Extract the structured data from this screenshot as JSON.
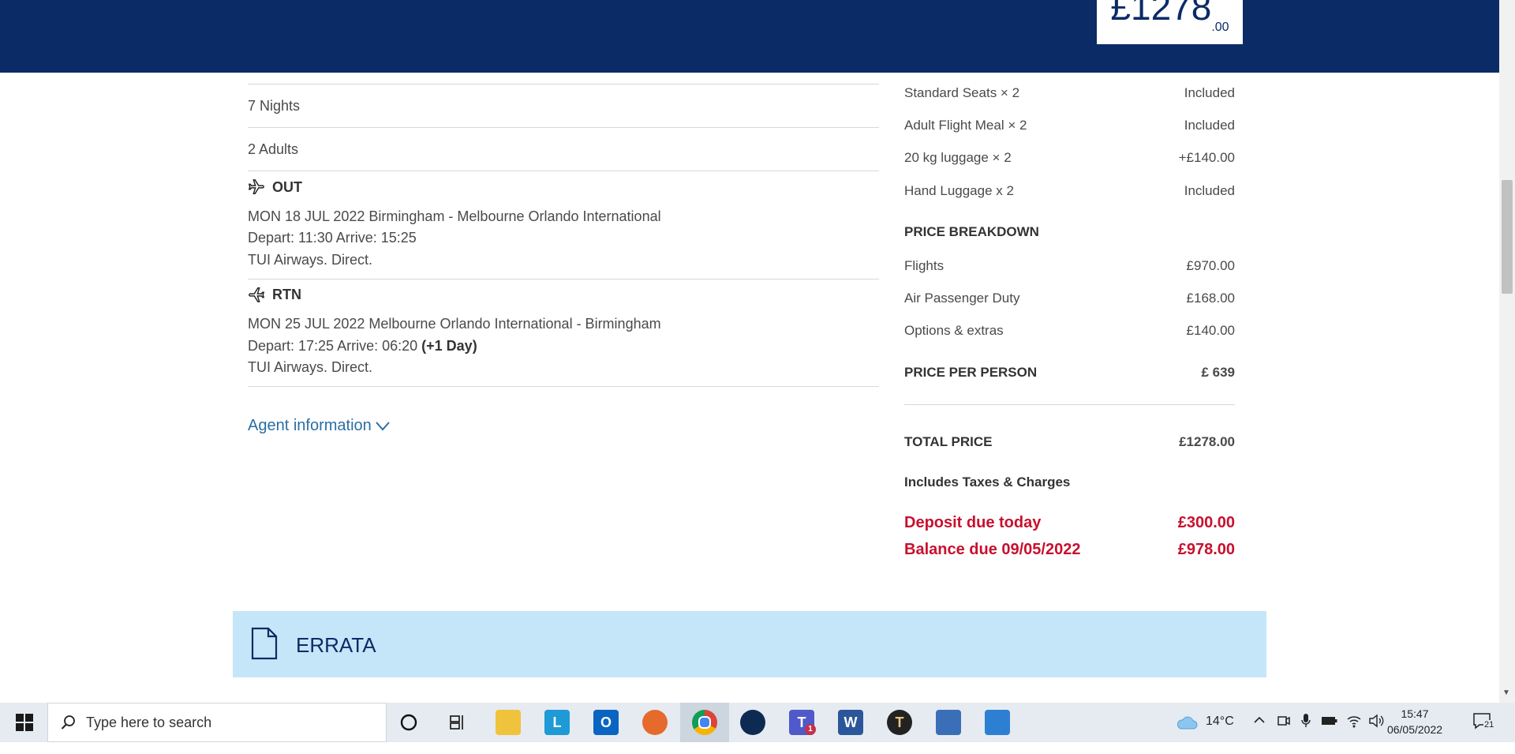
{
  "header": {
    "price_main": "£1278",
    "price_decimals": ".00"
  },
  "trip": {
    "nights": "7 Nights",
    "adults": "2  Adults",
    "out": {
      "label": "OUT",
      "route": "MON 18 JUL 2022 Birmingham  - Melbourne Orlando International",
      "times": "Depart: 11:30 Arrive: 15:25",
      "carrier": "TUI Airways. Direct."
    },
    "rtn": {
      "label": "RTN",
      "route": "MON 25 JUL 2022 Melbourne Orlando International - Birmingham",
      "times": "Depart: 17:25 Arrive: 06:20",
      "plus_day": "(+1 Day)",
      "carrier": "TUI Airways. Direct."
    },
    "agent_link": "Agent information"
  },
  "extras": [
    {
      "label": "Standard Seats × 2",
      "value": "Included"
    },
    {
      "label": "Adult Flight Meal × 2",
      "value": "Included"
    },
    {
      "label": "20 kg luggage × 2",
      "value": "+£140.00"
    },
    {
      "label": "Hand Luggage x 2",
      "value": "Included"
    }
  ],
  "breakdown": {
    "heading": "PRICE BREAKDOWN",
    "rows": [
      {
        "label": "Flights",
        "value": "£970.00"
      },
      {
        "label": "Air Passenger Duty",
        "value": "£168.00"
      },
      {
        "label": "Options & extras",
        "value": "£140.00"
      }
    ],
    "per_person_label": "PRICE PER PERSON",
    "per_person_value": "£ 639",
    "total_label": "TOTAL PRICE",
    "total_value": "£1278.00",
    "taxes_note": "Includes Taxes & Charges",
    "deposit_label": "Deposit due today",
    "deposit_value": "£300.00",
    "balance_label": "Balance due 09/05/2022",
    "balance_value": "£978.00",
    "accent_color": "#c8102e"
  },
  "errata": {
    "label": "ERRATA"
  },
  "taskbar": {
    "search_placeholder": "Type here to search",
    "weather": "14°C",
    "time": "15:47",
    "date": "06/05/2022",
    "notifications": "21",
    "teams_badge": "1",
    "apps": [
      "cortana-icon",
      "task-view-icon",
      "file-explorer-icon",
      "l-app-icon",
      "outlook-icon",
      "firefox-icon",
      "chrome-icon",
      "webex-icon",
      "teams-icon",
      "word-icon",
      "t-app-icon",
      "remote-desktop-icon",
      "photos-icon"
    ]
  }
}
